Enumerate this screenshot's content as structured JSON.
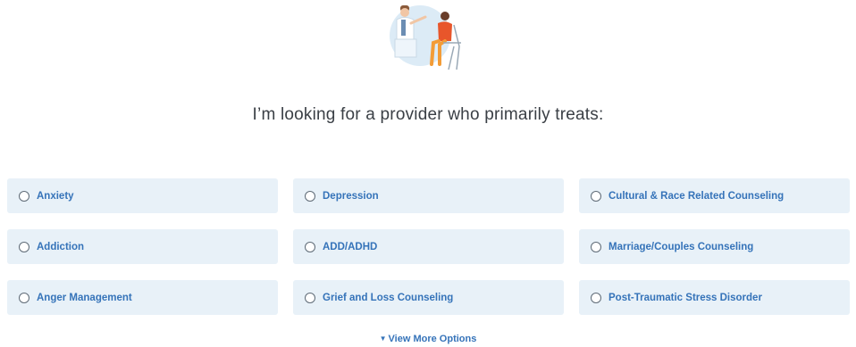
{
  "question": "I’m looking for a provider who primarily treats:",
  "illustration": {
    "icon": "provider-patient-illustration",
    "accent": "#dcebf6"
  },
  "options": [
    {
      "label": "Anxiety",
      "selected": false
    },
    {
      "label": "Depression",
      "selected": false
    },
    {
      "label": "Cultural & Race Related Counseling",
      "selected": false
    },
    {
      "label": "Addiction",
      "selected": false
    },
    {
      "label": "ADD/ADHD",
      "selected": false
    },
    {
      "label": "Marriage/Couples Counseling",
      "selected": false
    },
    {
      "label": "Anger Management",
      "selected": false
    },
    {
      "label": "Grief and Loss Counseling",
      "selected": false
    },
    {
      "label": "Post-Traumatic Stress Disorder",
      "selected": false
    }
  ],
  "view_more": {
    "label": "View More Options",
    "icon": "caret-down-icon"
  },
  "colors": {
    "link": "#3573b9",
    "option_bg": "#e8f1f8",
    "heading": "#3a3f45"
  }
}
